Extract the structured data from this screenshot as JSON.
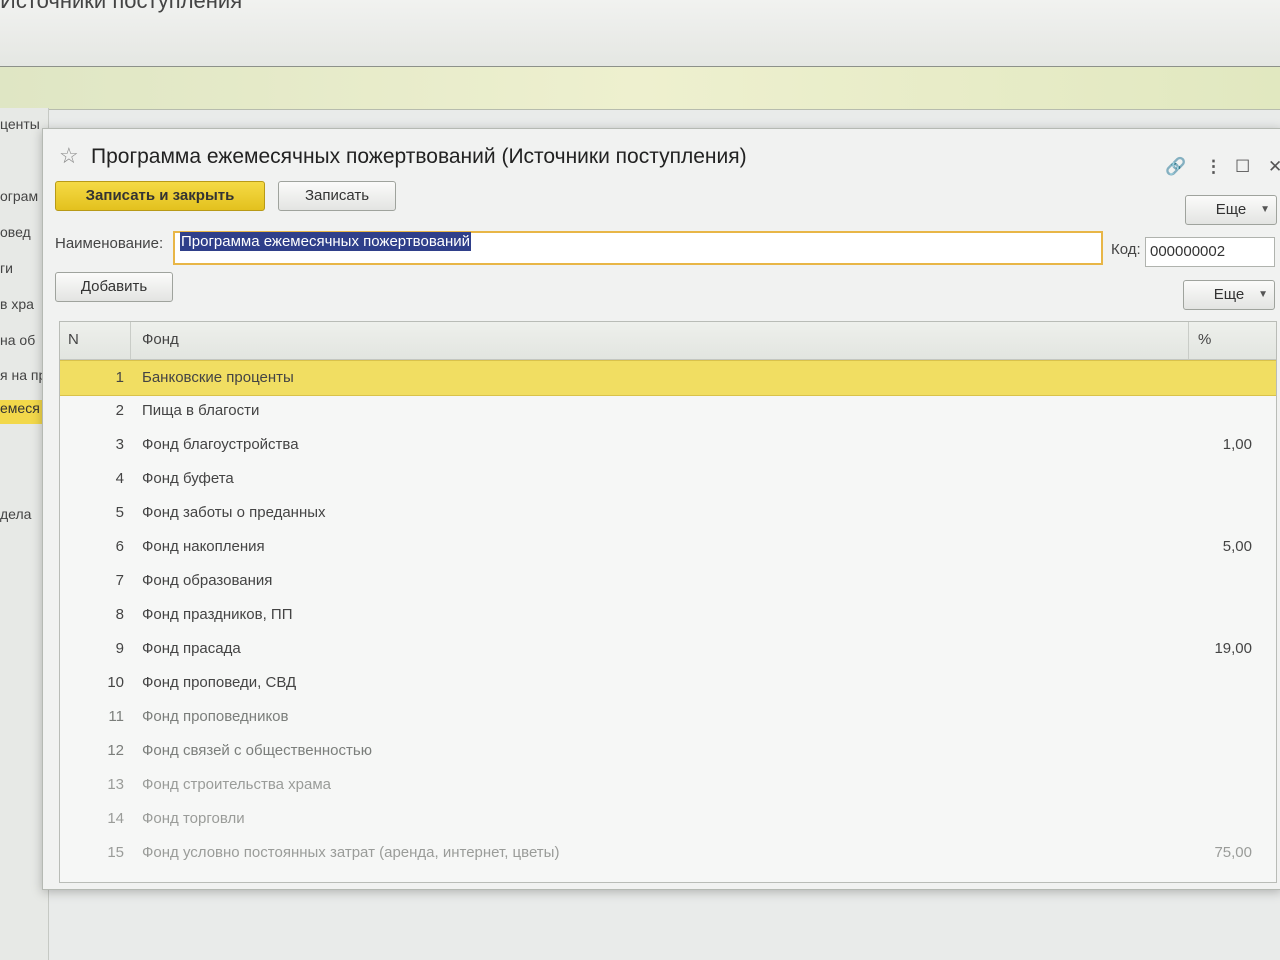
{
  "background": {
    "title": "Источники поступления",
    "left_items": [
      "центы",
      "ограм",
      "овед",
      "ги",
      "в хра",
      "на об",
      "я на пр",
      "емеся",
      "дела"
    ],
    "selected_index": 7
  },
  "dialog": {
    "title": "Программа ежемесячных пожертвований (Источники поступления)",
    "buttons": {
      "save_close": "Записать и закрыть",
      "save": "Записать",
      "more_top": "Еще",
      "add": "Добавить",
      "more_table": "Еще"
    },
    "name_label": "Наименование:",
    "name_value": "Программа ежемесячных пожертвований",
    "code_label": "Код:",
    "code_value": "000000002",
    "icons": [
      "star-icon",
      "link-icon",
      "more-vert-icon",
      "maximize-icon",
      "close-icon"
    ]
  },
  "table": {
    "columns": [
      "N",
      "Фонд",
      "%"
    ],
    "rows": [
      {
        "n": "1",
        "fund": "Банковские проценты",
        "pct": ""
      },
      {
        "n": "2",
        "fund": "Пища в благости",
        "pct": ""
      },
      {
        "n": "3",
        "fund": "Фонд благоустройства",
        "pct": "1,00"
      },
      {
        "n": "4",
        "fund": "Фонд буфета",
        "pct": ""
      },
      {
        "n": "5",
        "fund": "Фонд заботы о преданных",
        "pct": ""
      },
      {
        "n": "6",
        "fund": "Фонд накопления",
        "pct": "5,00"
      },
      {
        "n": "7",
        "fund": "Фонд образования",
        "pct": ""
      },
      {
        "n": "8",
        "fund": "Фонд праздников, ПП",
        "pct": ""
      },
      {
        "n": "9",
        "fund": "Фонд прасада",
        "pct": "19,00"
      },
      {
        "n": "10",
        "fund": "Фонд проповеди, СВД",
        "pct": ""
      },
      {
        "n": "11",
        "fund": "Фонд проповедников",
        "pct": ""
      },
      {
        "n": "12",
        "fund": "Фонд связей с общественностью",
        "pct": ""
      },
      {
        "n": "13",
        "fund": "Фонд строительства храма",
        "pct": ""
      },
      {
        "n": "14",
        "fund": "Фонд торговли",
        "pct": ""
      },
      {
        "n": "15",
        "fund": "Фонд условно постоянных затрат (аренда, интернет, цветы)",
        "pct": "75,00"
      }
    ],
    "selected_row": 0
  }
}
